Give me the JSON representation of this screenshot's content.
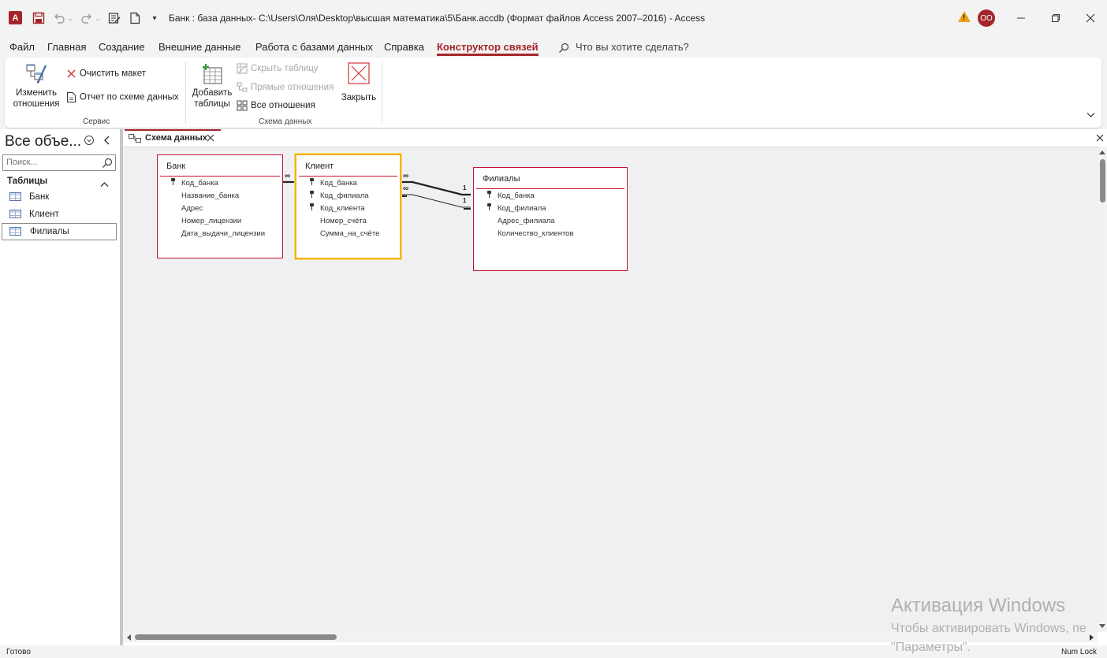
{
  "window": {
    "title": "Банк : база данных- C:\\Users\\Оля\\Desktop\\высшая математика\\5\\Банк.accdb (Формат файлов Access 2007–2016)  -  Access",
    "app_logo": "A",
    "avatar_initials": "OO",
    "accent_color": "#a4262c"
  },
  "menu": {
    "tabs": [
      {
        "label": "Файл"
      },
      {
        "label": "Главная"
      },
      {
        "label": "Создание"
      },
      {
        "label": "Внешние данные"
      },
      {
        "label": "Работа с базами данных"
      },
      {
        "label": "Справка"
      },
      {
        "label": "Конструктор связей",
        "active": true
      }
    ],
    "tell_me": "Что вы хотите сделать?"
  },
  "ribbon": {
    "edit_relations_line1": "Изменить",
    "edit_relations_line2": "отношения",
    "clear_layout": "Очистить макет",
    "schema_report": "Отчет по схеме данных",
    "group_service": "Сервис",
    "add_tables_line1": "Добавить",
    "add_tables_line2": "таблицы",
    "hide_table": "Скрыть таблицу",
    "direct_relations": "Прямые отношения",
    "all_relations": "Все отношения",
    "group_schema": "Схема данных",
    "close": "Закрыть"
  },
  "nav": {
    "title": "Все объе...",
    "search_placeholder": "Поиск...",
    "section": "Таблицы",
    "items": [
      {
        "label": "Банк"
      },
      {
        "label": "Клиент"
      },
      {
        "label": "Филиалы",
        "selected": true
      }
    ]
  },
  "document": {
    "tab_label": "Схема данных"
  },
  "diagram": {
    "tables": [
      {
        "name": "Банк",
        "fields": [
          {
            "name": "Код_банка",
            "key": true
          },
          {
            "name": "Название_банка",
            "key": false
          },
          {
            "name": "Адрес",
            "key": false
          },
          {
            "name": "Номер_лицензии",
            "key": false
          },
          {
            "name": "Дата_выдачи_лицензии",
            "key": false
          }
        ]
      },
      {
        "name": "Клиент",
        "selected": true,
        "fields": [
          {
            "name": "Код_банка",
            "key": true
          },
          {
            "name": "Код_филиала",
            "key": true
          },
          {
            "name": "Код_клиента",
            "key": true
          },
          {
            "name": "Номер_счёта",
            "key": false
          },
          {
            "name": "Сумма_на_счёте",
            "key": false
          }
        ]
      },
      {
        "name": "Филиалы",
        "fields": [
          {
            "name": "Код_банка",
            "key": true
          },
          {
            "name": "Код_филиала",
            "key": true
          },
          {
            "name": "Адрес_филиала",
            "key": false
          },
          {
            "name": "Количество_клиентов",
            "key": false
          }
        ]
      }
    ],
    "relation_labels": {
      "many": "∞",
      "one": "1"
    }
  },
  "watermark": {
    "line1": "Активация Windows",
    "line2": "Чтобы активировать Windows, пе",
    "line3": "\"Параметры\"."
  },
  "status": {
    "left": "Готово",
    "right": "Num Lock"
  }
}
